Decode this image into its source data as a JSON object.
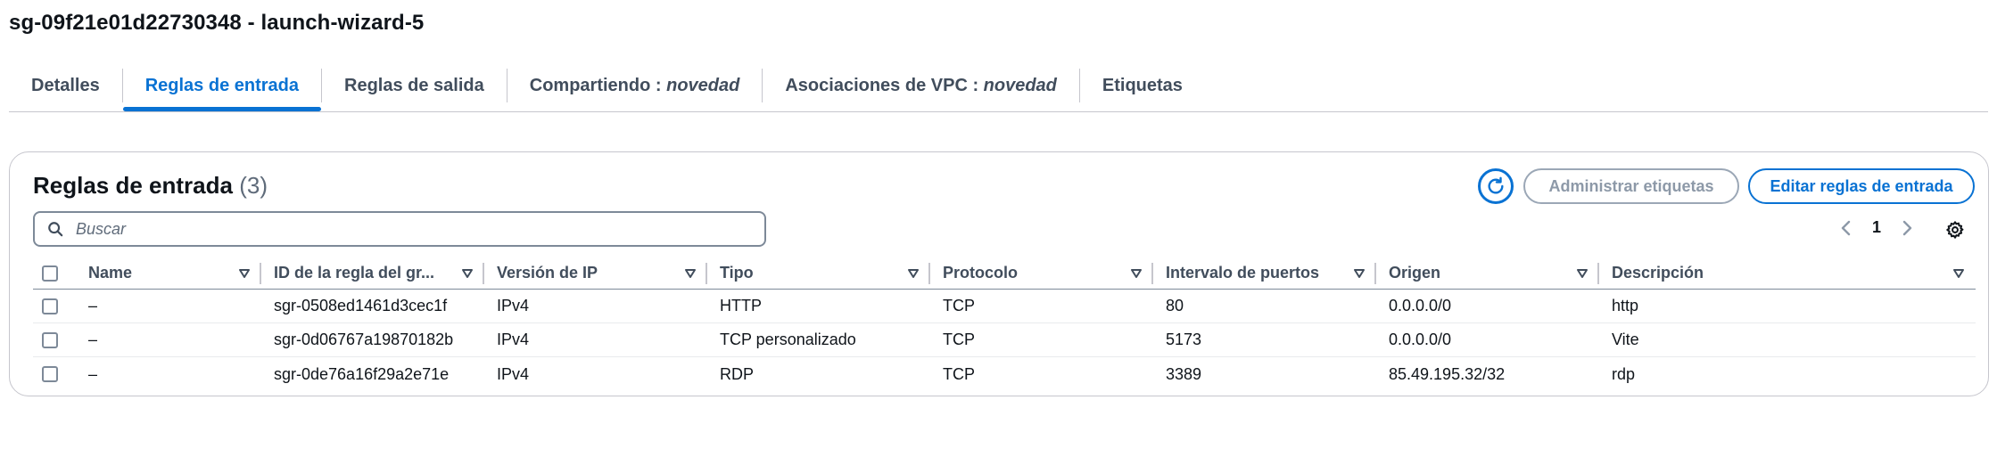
{
  "page": {
    "title": "sg-09f21e01d22730348 - launch-wizard-5"
  },
  "tabs": [
    {
      "label": "Detalles",
      "suffix": ""
    },
    {
      "label": "Reglas de entrada",
      "suffix": ""
    },
    {
      "label": "Reglas de salida",
      "suffix": ""
    },
    {
      "label": "Compartiendo : ",
      "suffix": "novedad"
    },
    {
      "label": "Asociaciones de VPC : ",
      "suffix": "novedad"
    },
    {
      "label": "Etiquetas",
      "suffix": ""
    }
  ],
  "active_tab": "Reglas de entrada",
  "panel": {
    "title": "Reglas de entrada",
    "count": "(3)",
    "refresh_icon": "refresh-icon",
    "manage_tags_label": "Administrar etiquetas",
    "edit_rules_label": "Editar reglas de entrada",
    "search_placeholder": "Buscar",
    "page_number": "1"
  },
  "table": {
    "columns": [
      "Name",
      "ID de la regla del gr...",
      "Versión de IP",
      "Tipo",
      "Protocolo",
      "Intervalo de puertos",
      "Origen",
      "Descripción"
    ],
    "rows": [
      [
        "–",
        "sgr-0508ed1461d3cec1f",
        "IPv4",
        "HTTP",
        "TCP",
        "80",
        "0.0.0.0/0",
        "http"
      ],
      [
        "–",
        "sgr-0d06767a19870182b",
        "IPv4",
        "TCP personalizado",
        "TCP",
        "5173",
        "0.0.0.0/0",
        "Vite"
      ],
      [
        "–",
        "sgr-0de76a16f29a2e71e",
        "IPv4",
        "RDP",
        "TCP",
        "3389",
        "85.49.195.32/32",
        "rdp"
      ]
    ]
  },
  "colors": {
    "accent": "#0972d3",
    "text": "#0f141a",
    "muted": "#5f6b7a",
    "border": "#c6c6cd"
  }
}
